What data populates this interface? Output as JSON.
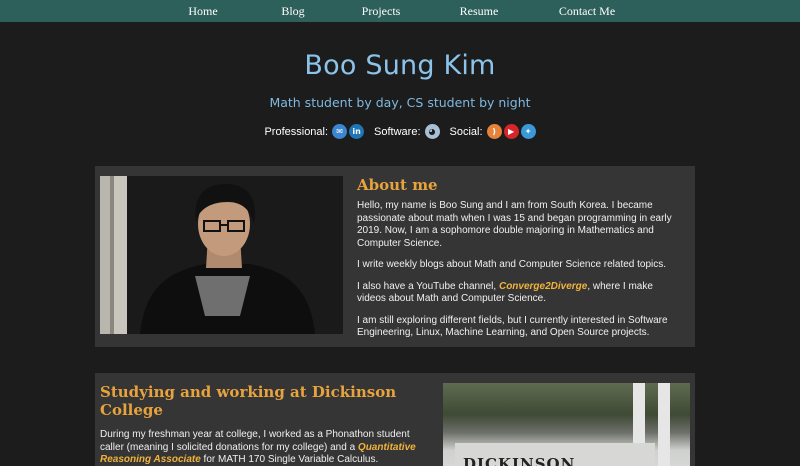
{
  "nav": {
    "home": "Home",
    "blog": "Blog",
    "projects": "Projects",
    "resume": "Resume",
    "contact": "Contact Me"
  },
  "header": {
    "title": "Boo Sung Kim",
    "subtitle": "Math student by day, CS student by night"
  },
  "links": {
    "professional_label": "Professional:",
    "software_label": "Software:",
    "social_label": "Social:",
    "icons": [
      "email-icon",
      "linkedin-icon",
      "github-icon",
      "rss-icon",
      "youtube-icon",
      "twitter-icon"
    ]
  },
  "about": {
    "heading": "About me",
    "p1": "Hello, my name is Boo Sung and I am from South Korea. I became passionate about math when I was 15 and began programming in early 2019. Now, I am a sophomore double majoring in Mathematics and Computer Science.",
    "p2": "I write weekly blogs about Math and Computer Science related topics.",
    "p3_before": "I also have a YouTube channel, ",
    "p3_link": "Converge2Diverge",
    "p3_after": ", where I make videos about Math and Computer Science.",
    "p4": "I am still exploring different fields, but I currently interested in Software Engineering, Linux, Machine Learning, and Open Source projects."
  },
  "study": {
    "heading": "Studying and working at Dickinson College",
    "p1_before": "During my freshman year at college, I worked as a Phonathon student caller (meaning I solicited donations for my college) and a ",
    "p1_link": "Quantitative Reasoning Associate",
    "p1_after": " for MATH 170 Single Variable Calculus.",
    "sign_text": "DICKINSON COLLEGE"
  },
  "colors": {
    "nav_bg": "#2d5f5b",
    "title": "#8cc3ea",
    "accent": "#e8a33d",
    "page_bg": "#1c1c1c",
    "card_bg": "#353535"
  }
}
